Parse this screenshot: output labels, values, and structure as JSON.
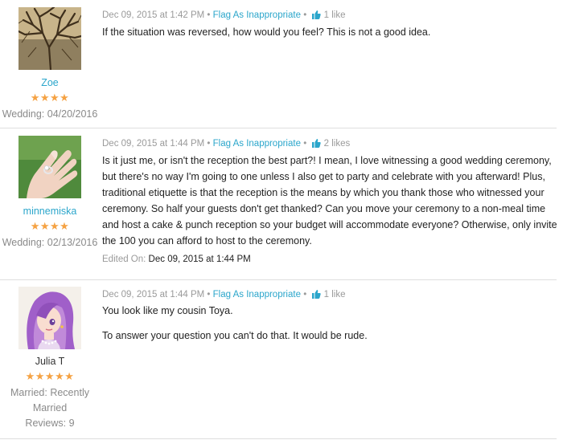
{
  "posts": [
    {
      "author": "Zoe",
      "stars": "★★★★",
      "meta": [
        "Wedding: 04/20/2016"
      ],
      "timestamp": "Dec 09, 2015 at 1:42 PM",
      "flag": "Flag As Inappropriate",
      "likes": "1 like",
      "body": [
        "If the situation was reversed, how would you feel? This is not a good idea."
      ],
      "avatar_icon": "tree-branches-avatar"
    },
    {
      "author": "minnemiska",
      "stars": "★★★★",
      "meta": [
        "Wedding: 02/13/2016"
      ],
      "timestamp": "Dec 09, 2015 at 1:44 PM",
      "flag": "Flag As Inappropriate",
      "likes": "2 likes",
      "body": [
        "Is it just me, or isn't the reception the best part?! I mean, I love witnessing a good wedding ceremony, but there's no way I'm going to one unless I also get to party and celebrate with you afterward! Plus, traditional etiquette is that the reception is the means by which you thank those who witnessed your ceremony. So half your guests don't get thanked? Can you move your ceremony to a non-meal time and host a cake & punch reception so your budget will accommodate everyone? Otherwise, only invite the 100 you can afford to host to the ceremony."
      ],
      "edited_label": "Edited On:",
      "edited_time": "Dec 09, 2015 at 1:44 PM",
      "avatar_icon": "engagement-ring-hand-avatar"
    },
    {
      "author": "Julia T",
      "stars": "★★★★★",
      "meta": [
        "Married: Recently",
        "Married",
        "Reviews: 9"
      ],
      "timestamp": "Dec 09, 2015 at 1:44 PM",
      "flag": "Flag As Inappropriate",
      "likes": "1 like",
      "body": [
        "You look like my cousin Toya.",
        "To answer your question you can't do that. It would be rude."
      ],
      "avatar_icon": "purple-hair-cartoon-avatar"
    }
  ],
  "separator": "•",
  "colors": {
    "link": "#2ba6cb",
    "stars": "#f5a243",
    "muted": "#9a9a9a"
  }
}
